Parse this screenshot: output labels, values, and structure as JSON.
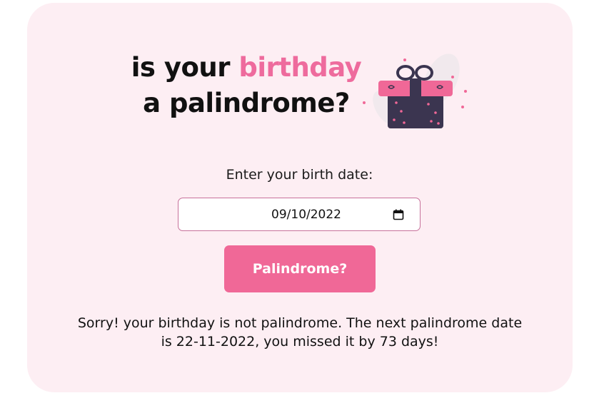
{
  "header": {
    "title_part1": "is your ",
    "title_accent": "birthday",
    "title_line2": "a palindrome?"
  },
  "form": {
    "label": "Enter your birth date:",
    "date_value": "09/10/2022",
    "button_label": "Palindrome?"
  },
  "result": {
    "line1": "Sorry! your birthday is not palindrome. The next palindrome date",
    "line2": "is 22-11-2022, you missed it by 73 days!"
  },
  "icons": {
    "gift": "gift-box-icon",
    "calendar": "calendar-icon"
  },
  "colors": {
    "accent": "#ee6b9d",
    "button": "#f06897",
    "card_background": "#fdeef3",
    "gift_body": "#3b3550"
  }
}
